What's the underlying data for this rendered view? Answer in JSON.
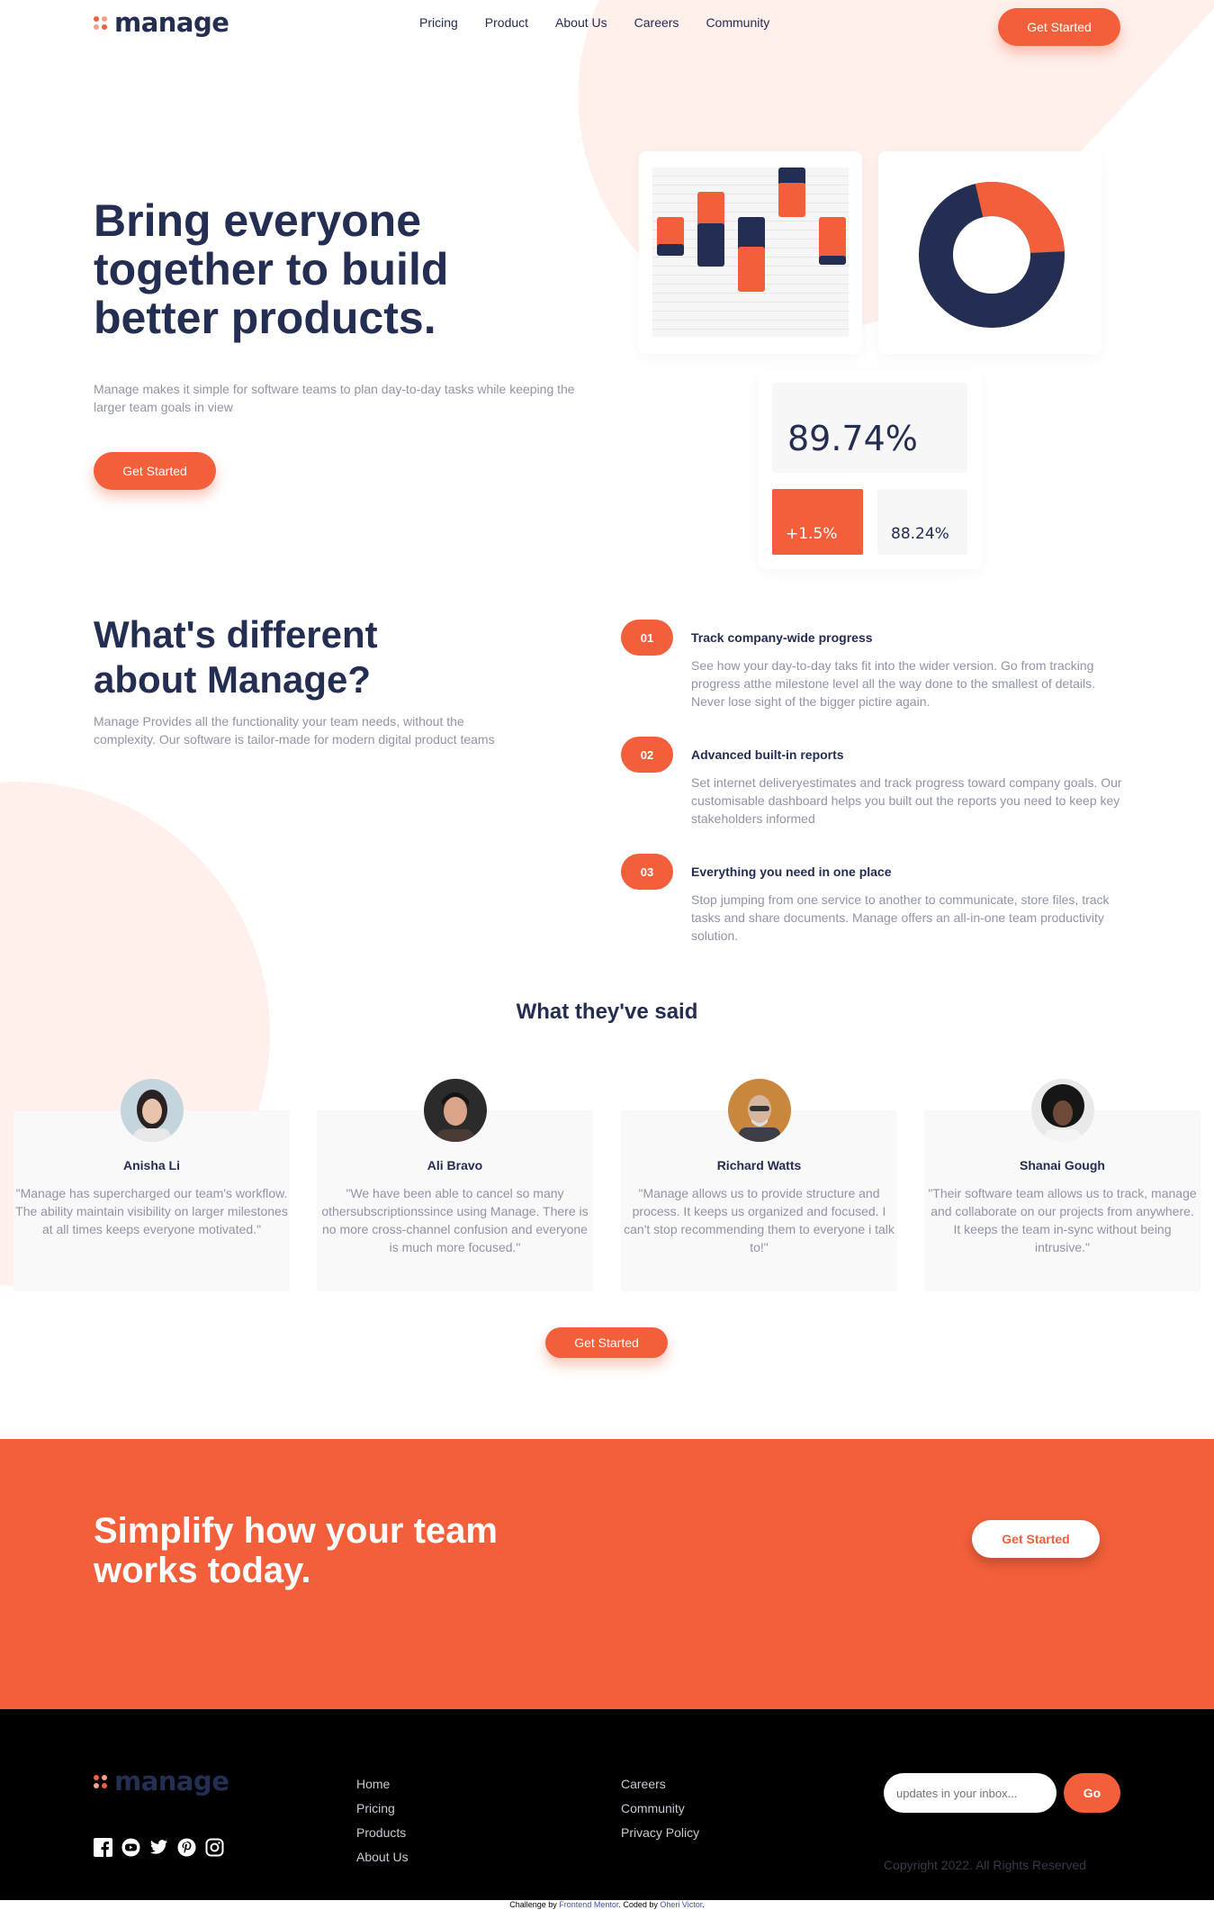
{
  "brand": {
    "name": "manage",
    "accent": "#f25f3a",
    "dark": "#242d52"
  },
  "nav": {
    "items": [
      "Pricing",
      "Product",
      "About Us",
      "Careers",
      "Community"
    ],
    "cta": "Get Started"
  },
  "hero": {
    "title": "Bring everyone together to build better products.",
    "description": "Manage makes it simple for software teams to plan day-to-day tasks while keeping the larger team goals in view",
    "cta": "Get Started",
    "stats": {
      "main": "89.74%",
      "change": "+1.5%",
      "secondary": "88.24%"
    }
  },
  "different": {
    "title": "What's different about Manage?",
    "description": "Manage Provides all the functionality your team needs, without the complexity. Our software is tailor-made for modern digital product teams",
    "features": [
      {
        "num": "01",
        "title": "Track company-wide progress",
        "desc": "See how your day-to-day taks fit into the wider version. Go from tracking progress atthe milestone level all the way done to the smallest of details. Never lose sight of the bigger pictire again."
      },
      {
        "num": "02",
        "title": "Advanced built-in reports",
        "desc": "Set internet deliveryestimates and track progress toward company goals. Our customisable dashboard helps you built out the reports you need to keep key stakeholders informed"
      },
      {
        "num": "03",
        "title": "Everything you need in one place",
        "desc": "Stop jumping from one service to another to communicate, store files, track tasks and share documents. Manage offers an all-in-one team productivity solution."
      }
    ]
  },
  "testimonials": {
    "title": "What they've said",
    "items": [
      {
        "name": "Anisha Li",
        "quote": "\"Manage has supercharged our team's workflow. The ability maintain visibility on larger milestones at all times keeps everyone motivated.\""
      },
      {
        "name": "Ali Bravo",
        "quote": "\"We have been able to cancel so many othersubscriptionssince using Manage. There is no more cross-channel confusion and everyone is much more focused.\""
      },
      {
        "name": "Richard Watts",
        "quote": "\"Manage allows us to provide structure and process. It keeps us organized and focused. I can't stop recommending them to everyone i talk to!\""
      },
      {
        "name": "Shanai Gough",
        "quote": "\"Their software team allows us to track, manage and collaborate on our projects from anywhere. It keeps the team in-sync without being intrusive.\""
      }
    ],
    "cta": "Get Started"
  },
  "cta_band": {
    "title": "Simplify how your team works today.",
    "cta": "Get Started"
  },
  "footer": {
    "col1": [
      "Home",
      "Pricing",
      "Products",
      "About Us"
    ],
    "col2": [
      "Careers",
      "Community",
      "Privacy Policy"
    ],
    "newsletter_placeholder": "updates in your inbox...",
    "go": "Go",
    "copyright": "Copyright 2022. All Rights Reserved",
    "socials": [
      "facebook-icon",
      "youtube-icon",
      "twitter-icon",
      "pinterest-icon",
      "instagram-icon"
    ]
  },
  "attribution": {
    "prefix": "Challenge by ",
    "fm": "Frontend Mentor",
    "mid": ". Coded by ",
    "author": "Oheri Victor",
    "suffix": "."
  }
}
